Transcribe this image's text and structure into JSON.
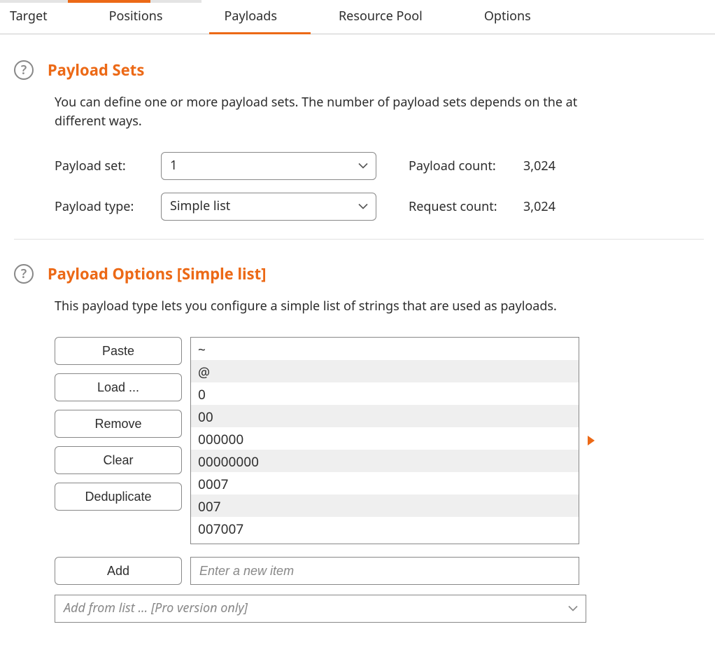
{
  "tabs": {
    "items": [
      {
        "label": "Target"
      },
      {
        "label": "Positions"
      },
      {
        "label": "Payloads"
      },
      {
        "label": "Resource Pool"
      },
      {
        "label": "Options"
      }
    ],
    "active_index": 2
  },
  "payload_sets": {
    "title": "Payload Sets",
    "description_line1": "You can define one or more payload sets. The number of payload sets depends on the at",
    "description_line2": "different ways.",
    "set_label": "Payload set:",
    "set_value": "1",
    "type_label": "Payload type:",
    "type_value": "Simple list",
    "payload_count_label": "Payload count:",
    "payload_count_value": "3,024",
    "request_count_label": "Request count:",
    "request_count_value": "3,024"
  },
  "payload_options": {
    "title": "Payload Options [Simple list]",
    "description": "This payload type lets you configure a simple list of strings that are used as payloads.",
    "buttons": {
      "paste": "Paste",
      "load": "Load ...",
      "remove": "Remove",
      "clear": "Clear",
      "dedup": "Deduplicate",
      "add": "Add"
    },
    "list_items": [
      "~",
      "@",
      "0",
      "00",
      "000000",
      "00000000",
      "0007",
      "007",
      "007007"
    ],
    "add_placeholder": "Enter a new item",
    "add_from_list_text": "Add from list ... [Pro version only]"
  },
  "icons": {
    "help": "?"
  }
}
